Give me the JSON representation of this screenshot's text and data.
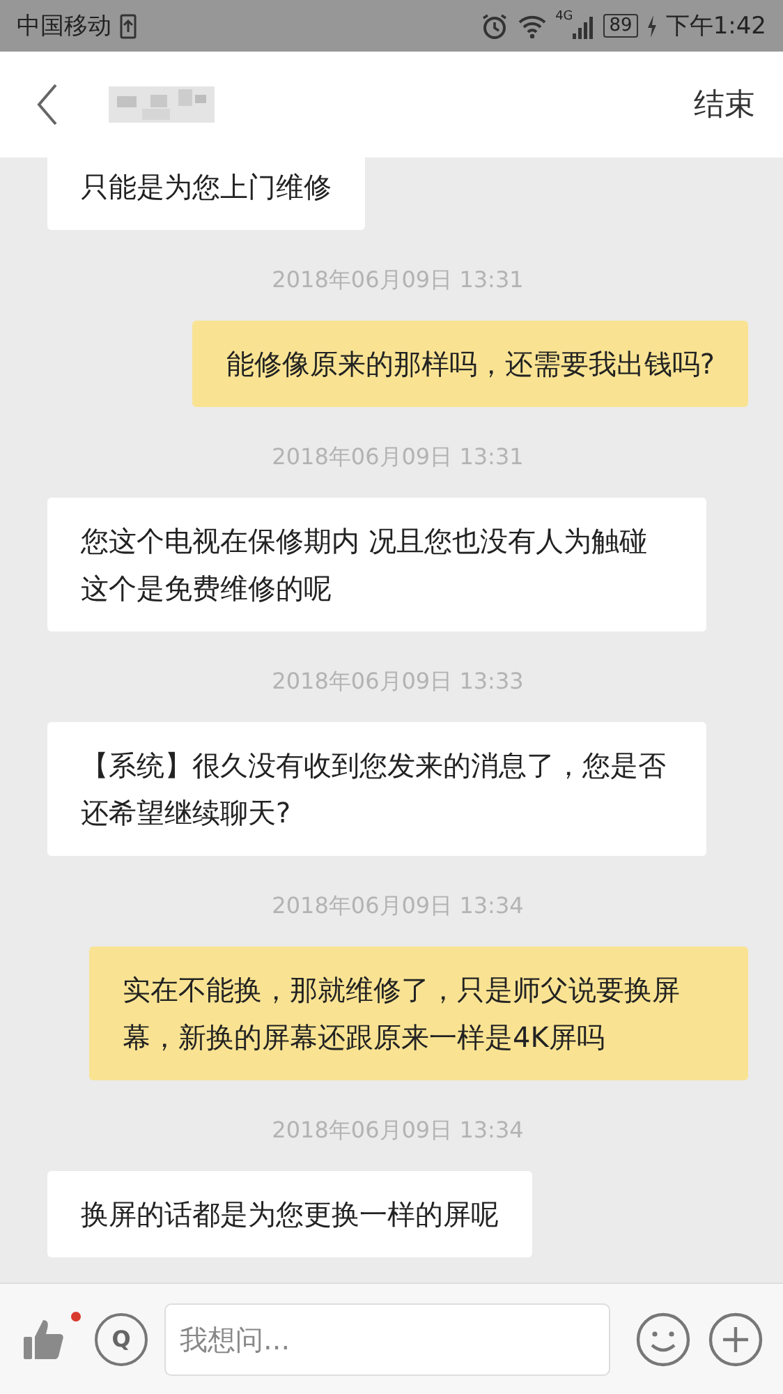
{
  "status_bar": {
    "carrier": "中国移动",
    "network": "4G",
    "battery": "89",
    "time": "下午1:42"
  },
  "header": {
    "action": "结束"
  },
  "messages": [
    {
      "kind": "incoming",
      "text": "只能是为您上门维修"
    },
    {
      "kind": "time",
      "text": "2018年06月09日 13:31"
    },
    {
      "kind": "outgoing",
      "text": "能修像原来的那样吗，还需要我出钱吗?"
    },
    {
      "kind": "time",
      "text": "2018年06月09日 13:31"
    },
    {
      "kind": "incoming",
      "text": "您这个电视在保修期内 况且您也没有人为触碰这个是免费维修的呢"
    },
    {
      "kind": "time",
      "text": "2018年06月09日 13:33"
    },
    {
      "kind": "incoming",
      "text": "【系统】很久没有收到您发来的消息了，您是否还希望继续聊天?"
    },
    {
      "kind": "time",
      "text": "2018年06月09日 13:34"
    },
    {
      "kind": "outgoing",
      "text": "实在不能换，那就维修了，只是师父说要换屏幕，新换的屏幕还跟原来一样是4K屏吗"
    },
    {
      "kind": "time",
      "text": "2018年06月09日 13:34"
    },
    {
      "kind": "incoming",
      "text": "换屏的话都是为您更换一样的屏呢"
    }
  ],
  "input_bar": {
    "like_unread": true,
    "ask_label": "Q",
    "placeholder": "我想问..."
  }
}
